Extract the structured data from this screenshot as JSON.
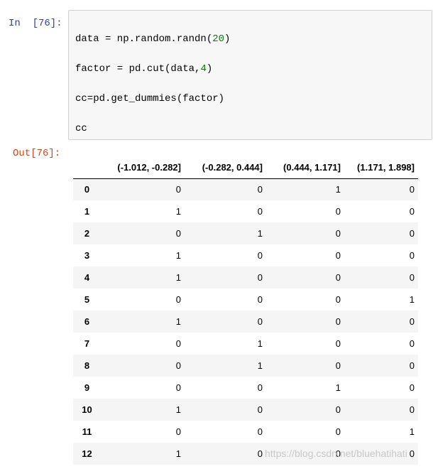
{
  "input_prompt": "In  [76]:",
  "output_prompt": "Out[76]:",
  "code": {
    "line1_pre": "data = np.random.randn(",
    "line1_num": "20",
    "line1_post": ")",
    "line2_pre": "factor = pd.cut(data,",
    "line2_num": "4",
    "line2_post": ")",
    "line3": "cc=pd.get_dummies(factor)",
    "line4": "cc"
  },
  "table": {
    "columns": [
      "(-1.012, -0.282]",
      "(-0.282, 0.444]",
      "(0.444, 1.171]",
      "(1.171, 1.898]"
    ],
    "rows": [
      {
        "index": "0",
        "values": [
          "0",
          "0",
          "1",
          "0"
        ]
      },
      {
        "index": "1",
        "values": [
          "1",
          "0",
          "0",
          "0"
        ]
      },
      {
        "index": "2",
        "values": [
          "0",
          "1",
          "0",
          "0"
        ]
      },
      {
        "index": "3",
        "values": [
          "1",
          "0",
          "0",
          "0"
        ]
      },
      {
        "index": "4",
        "values": [
          "1",
          "0",
          "0",
          "0"
        ]
      },
      {
        "index": "5",
        "values": [
          "0",
          "0",
          "0",
          "1"
        ]
      },
      {
        "index": "6",
        "values": [
          "1",
          "0",
          "0",
          "0"
        ]
      },
      {
        "index": "7",
        "values": [
          "0",
          "1",
          "0",
          "0"
        ]
      },
      {
        "index": "8",
        "values": [
          "0",
          "1",
          "0",
          "0"
        ]
      },
      {
        "index": "9",
        "values": [
          "0",
          "0",
          "1",
          "0"
        ]
      },
      {
        "index": "10",
        "values": [
          "1",
          "0",
          "0",
          "0"
        ]
      },
      {
        "index": "11",
        "values": [
          "0",
          "0",
          "0",
          "1"
        ]
      },
      {
        "index": "12",
        "values": [
          "1",
          "0",
          "0",
          "0"
        ]
      }
    ]
  },
  "watermark": "https://blog.csdn.net/bluehatihati"
}
